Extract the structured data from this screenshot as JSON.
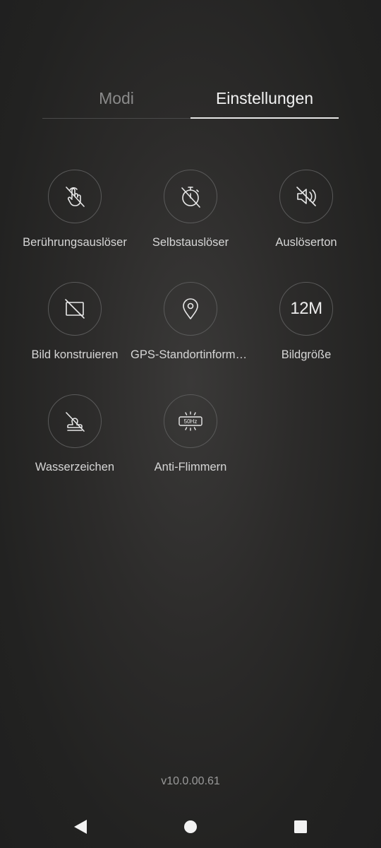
{
  "tabs": {
    "modes": "Modi",
    "settings": "Einstellungen"
  },
  "settings": [
    {
      "label": "Berührungsauslöser",
      "icon": "touch-off-icon"
    },
    {
      "label": "Selbstauslöser",
      "icon": "timer-off-icon"
    },
    {
      "label": "Auslöserton",
      "icon": "sound-off-icon"
    },
    {
      "label": "Bild konstruieren",
      "icon": "frame-off-icon"
    },
    {
      "label": "GPS-Standortinforma…",
      "icon": "location-pin-icon"
    },
    {
      "label": "Bildgröße",
      "icon": "image-size-icon",
      "icon_text": "12M"
    },
    {
      "label": "Wasserzeichen",
      "icon": "watermark-off-icon"
    },
    {
      "label": "Anti-Flimmern",
      "icon": "anti-flicker-icon",
      "icon_text": "50Hz"
    }
  ],
  "version": "v10.0.00.61",
  "navbar": {
    "back": "back-icon",
    "home": "home-icon",
    "recent": "recent-apps-icon"
  }
}
